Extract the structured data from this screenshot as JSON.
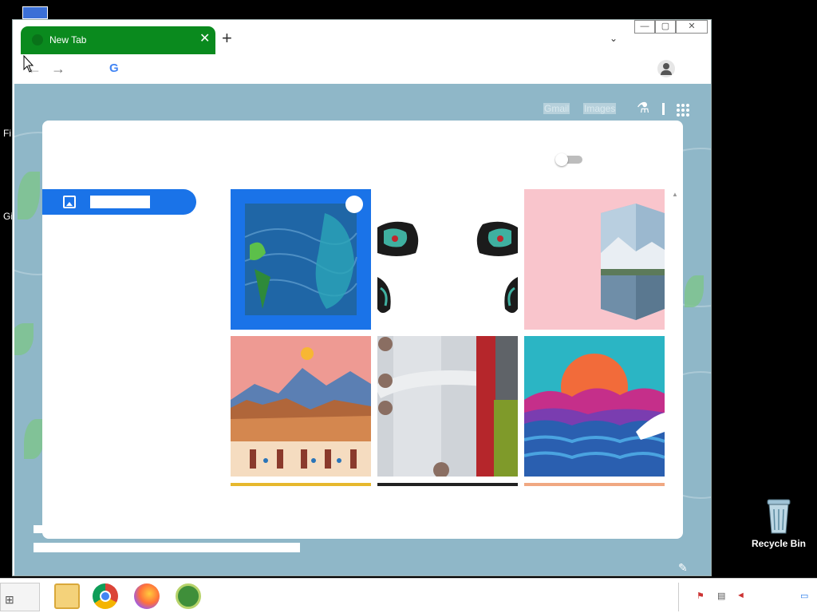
{
  "desktop": {
    "partial_labels": [
      "Fi",
      "Gi"
    ],
    "recycle_bin": "Recycle Bin"
  },
  "browser": {
    "tab_title": "New Tab",
    "new_tab_symbol": "+",
    "tab_close_symbol": "✕",
    "tab_list_symbol": "⌄",
    "window_buttons": [
      "—",
      "▢",
      "✕"
    ],
    "nav": {
      "back": "←",
      "forward": "→",
      "google_mark": "G"
    }
  },
  "ntp": {
    "top_links": [
      "Gmail",
      "Images"
    ],
    "colors": {
      "accent": "#1a73e8",
      "tab_green": "#0a8a1e",
      "ntp_bg": "#8fb7c8"
    }
  },
  "customize_dialog": {
    "sidebar_selected": "Background",
    "toggle_on": false,
    "tiles": [
      {
        "name": "ocean-whale-art",
        "selected": true
      },
      {
        "name": "haida-ravens-art",
        "selected": false
      },
      {
        "name": "mountain-cube-art",
        "selected": false
      },
      {
        "name": "desert-mountains-art",
        "selected": false
      },
      {
        "name": "abstract-grey-red-art",
        "selected": false
      },
      {
        "name": "sunset-waves-art",
        "selected": false
      }
    ]
  },
  "taskbar": {
    "apps": [
      "file-explorer",
      "chrome",
      "firefox",
      "app-green"
    ]
  }
}
